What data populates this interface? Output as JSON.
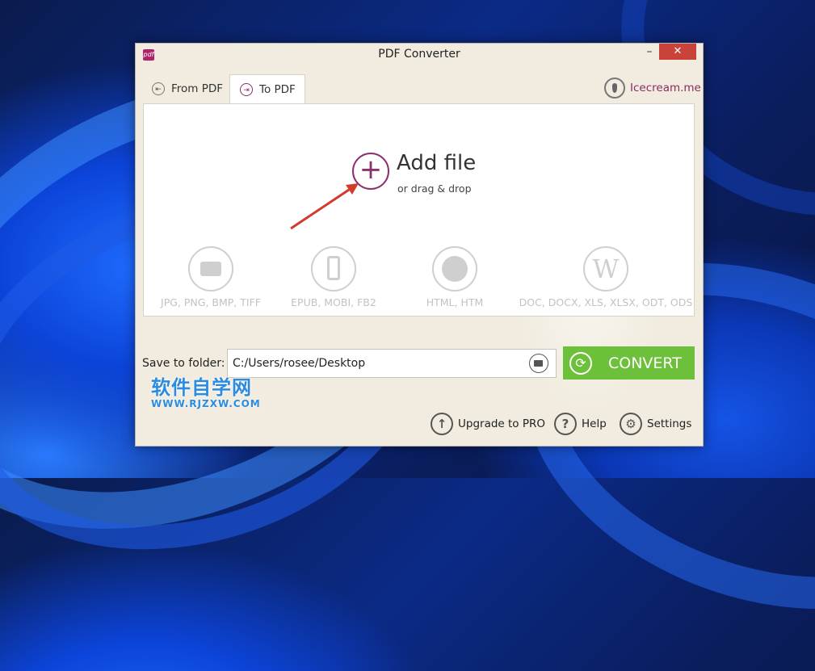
{
  "window": {
    "title": "PDF Converter",
    "minimize": "–",
    "close": "✕",
    "app_icon": "pdf"
  },
  "tabs": [
    {
      "label": "From PDF",
      "icon": "from-pdf-icon",
      "active": false
    },
    {
      "label": "To PDF",
      "icon": "to-pdf-icon",
      "active": true
    }
  ],
  "brand_link": {
    "label": "Icecream.me",
    "icon": "icecream-icon"
  },
  "drop_area": {
    "title": "Add file",
    "subtitle": "or drag & drop",
    "add_symbol": "+",
    "formats": [
      {
        "label": "JPG, PNG, BMP, TIFF",
        "icon": "camera-icon"
      },
      {
        "label": "EPUB, MOBI, FB2",
        "icon": "phone-icon"
      },
      {
        "label": "HTML, HTM",
        "icon": "globe-icon"
      },
      {
        "label": "DOC, DOCX, XLS, XLSX, ODT, ODS",
        "icon": "word-icon",
        "glyph": "W"
      }
    ]
  },
  "save": {
    "label": "Save to folder:",
    "path": "C:/Users/rosee/Desktop"
  },
  "convert": {
    "label": "CONVERT",
    "icon": "refresh-icon",
    "color": "#6cc03a"
  },
  "footer": {
    "upgrade": "Upgrade to PRO",
    "help": "Help",
    "help_symbol": "?",
    "settings": "Settings"
  },
  "watermark": {
    "text": "软件自学网",
    "url": "WWW.RJZXW.COM"
  },
  "colors": {
    "accent": "#8c2f6d",
    "close": "#c9433a",
    "window_bg": "#f1ecdf"
  }
}
